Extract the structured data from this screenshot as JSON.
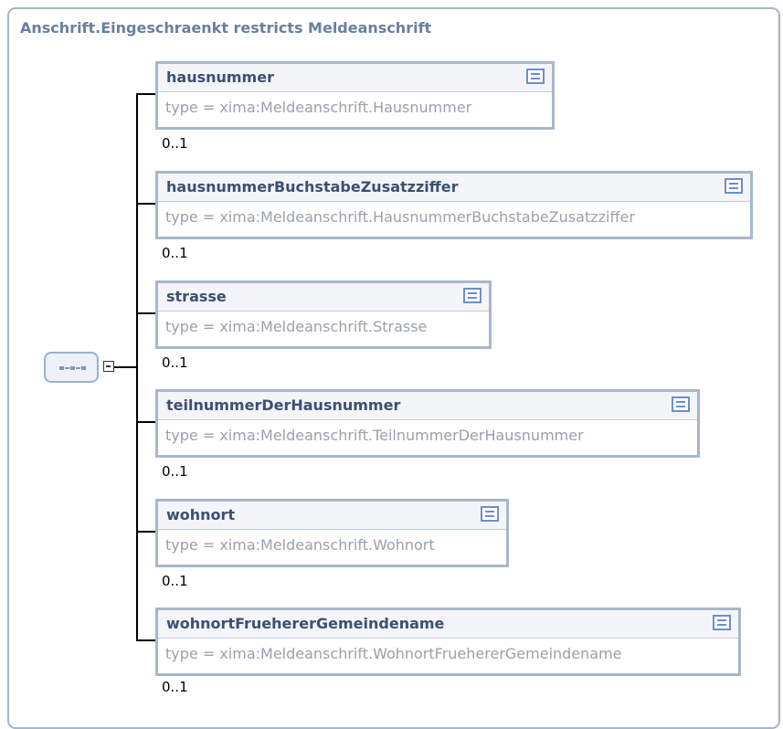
{
  "diagram": {
    "title": "Anschrift.Eingeschraenkt restricts Meldeanschrift",
    "compositor": {
      "kind": "sequence",
      "icon": "sequence-icon",
      "toggle_icon": "collapse-minus-icon"
    },
    "elements": [
      {
        "name": "hausnummer",
        "type": "type = xima:Meldeanschrift.Hausnummer",
        "cardinality": "0..1"
      },
      {
        "name": "hausnummerBuchstabeZusatzziffer",
        "type": "type = xima:Meldeanschrift.HausnummerBuchstabeZusatzziffer",
        "cardinality": "0..1"
      },
      {
        "name": "strasse",
        "type": "type = xima:Meldeanschrift.Strasse",
        "cardinality": "0..1"
      },
      {
        "name": "teilnummerDerHausnummer",
        "type": "type = xima:Meldeanschrift.TeilnummerDerHausnummer",
        "cardinality": "0..1"
      },
      {
        "name": "wohnort",
        "type": "type = xima:Meldeanschrift.Wohnort",
        "cardinality": "0..1"
      },
      {
        "name": "wohnortFruehererGemeindename",
        "type": "type = xima:Meldeanschrift.WohnortFruehererGemeindename",
        "cardinality": "0..1"
      }
    ]
  },
  "colors": {
    "box_border": "#a9b6ca",
    "title_text": "#6a7f9f",
    "element_name": "#3d4f72",
    "type_text": "#9aa1ab",
    "doc_icon": "#6c8fcb"
  }
}
